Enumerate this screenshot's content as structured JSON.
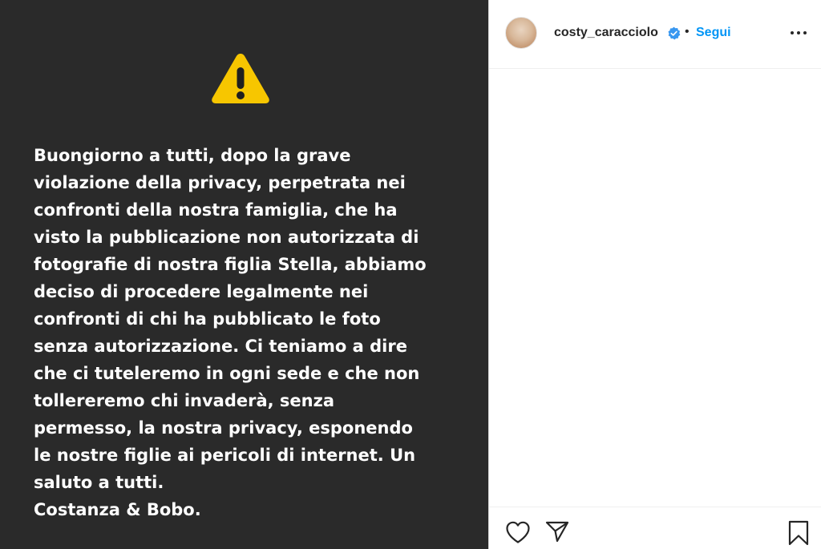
{
  "post": {
    "text_lines": [
      "Buongiorno a tutti, dopo la grave",
      "violazione della  privacy, perpetrata nei",
      "confronti della nostra famiglia, che ha",
      "visto la pubblicazione non autorizzata di",
      "fotografie di nostra figlia Stella, abbiamo",
      "deciso di procedere legalmente nei",
      "confronti di chi ha pubblicato le foto",
      "senza autorizzazione. Ci teniamo a dire",
      "che ci tuteleremo in ogni sede e che non",
      "tollereremo chi invaderà, senza",
      "permesso, la nostra privacy, esponendo",
      "le nostre figlie ai pericoli di internet. Un",
      "saluto a tutti.",
      "Costanza & Bobo."
    ],
    "background_color": "#2a2a2a",
    "text_color": "#ffffff",
    "icon": "warning-icon",
    "icon_color": "#f7c600"
  },
  "header": {
    "username": "costy_caracciolo",
    "verified_icon": "verified-badge-icon",
    "separator": "•",
    "follow_label": "Segui",
    "follow_color": "#0095f6",
    "more_icon": "more-options-icon"
  },
  "actions": {
    "like_icon": "heart-icon",
    "share_icon": "paper-plane-icon",
    "save_icon": "bookmark-icon"
  }
}
